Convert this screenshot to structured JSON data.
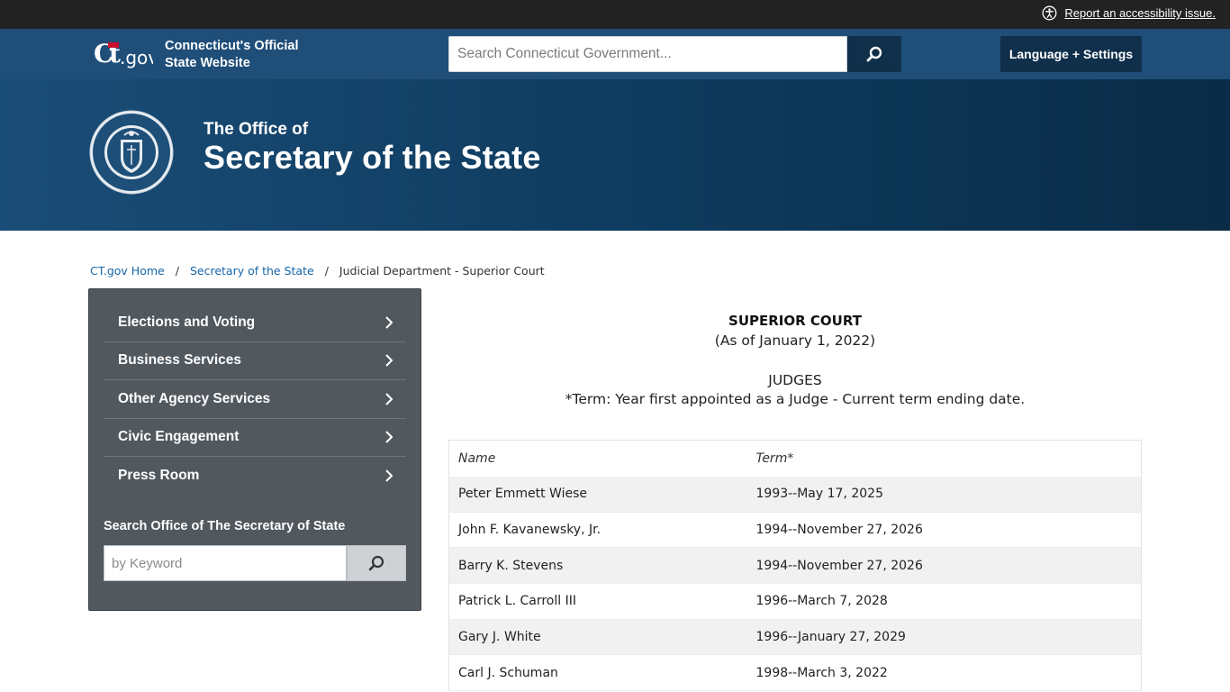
{
  "topbar": {
    "accessibility_link": "Report an accessibility issue."
  },
  "header": {
    "logo_text_line1": "Connecticut's Official",
    "logo_text_line2": "State Website",
    "search_placeholder": "Search Connecticut Government...",
    "language_button": "Language + Settings"
  },
  "banner": {
    "subtitle": "The Office of",
    "title": "Secretary of the State"
  },
  "breadcrumb": {
    "items": [
      "CT.gov Home",
      "Secretary of the State"
    ],
    "current": "Judicial Department - Superior Court",
    "separator": "/"
  },
  "sidebar": {
    "items": [
      {
        "label": "Elections and Voting"
      },
      {
        "label": "Business Services"
      },
      {
        "label": "Other Agency Services"
      },
      {
        "label": "Civic Engagement"
      },
      {
        "label": "Press Room"
      }
    ],
    "search_label": "Search Office of The Secretary of State",
    "search_placeholder": "by Keyword"
  },
  "main": {
    "title": "SUPERIOR COURT",
    "date": "(As of January 1, 2022)",
    "judges_heading": "JUDGES",
    "term_note": "*Term: Year first appointed as a Judge - Current term ending date.",
    "table": {
      "headers": [
        "Name",
        "Term*"
      ],
      "rows": [
        [
          "Peter Emmett Wiese",
          "1993--May 17, 2025"
        ],
        [
          "John F. Kavanewsky, Jr.",
          "1994--November 27, 2026"
        ],
        [
          "Barry K. Stevens",
          "1994--November 27, 2026"
        ],
        [
          "Patrick L. Carroll III",
          "1996--March 7, 2028"
        ],
        [
          "Gary J. White",
          "1996--January 27, 2029"
        ],
        [
          "Carl J. Schuman",
          "1998--March 3, 2022"
        ]
      ]
    }
  },
  "colors": {
    "topbar": "#222222",
    "header": "#1f4e79",
    "button_dark": "#0f2f4a",
    "sidebar": "#51585e",
    "link": "#1565a8"
  },
  "icons": {
    "accessibility": "accessibility-icon",
    "search": "search-icon",
    "chevron": "chevron-right-icon",
    "seal": "state-seal-icon",
    "logo": "ct-gov-logo"
  }
}
